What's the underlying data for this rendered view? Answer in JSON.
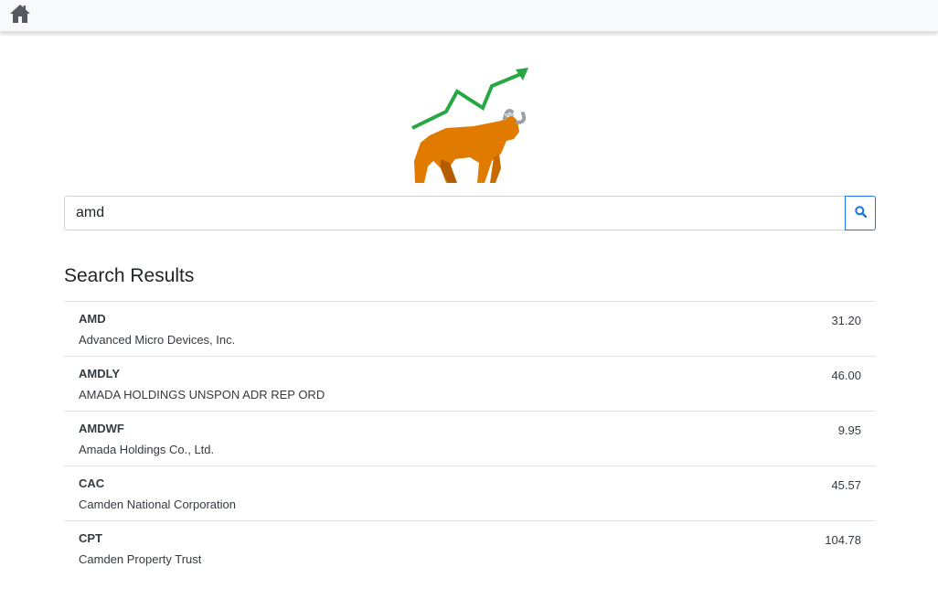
{
  "nav": {
    "home_icon": "home-icon"
  },
  "logo": {
    "icon": "bull-with-rising-chart-logo",
    "colors": {
      "arrow": "#27a844",
      "bull": "#e07b00",
      "bull_dark": "#b35c00",
      "horn": "#9aa0a6"
    }
  },
  "search": {
    "value": "amd",
    "icon": "search-icon",
    "accent": "#1a73e8"
  },
  "results": {
    "title": "Search Results",
    "items": [
      {
        "symbol": "AMD",
        "name": "Advanced Micro Devices, Inc.",
        "price": "31.20"
      },
      {
        "symbol": "AMDLY",
        "name": "AMADA HOLDINGS UNSPON ADR REP ORD",
        "price": "46.00"
      },
      {
        "symbol": "AMDWF",
        "name": "Amada Holdings Co., Ltd.",
        "price": "9.95"
      },
      {
        "symbol": "CAC",
        "name": "Camden National Corporation",
        "price": "45.57"
      },
      {
        "symbol": "CPT",
        "name": "Camden Property Trust",
        "price": "104.78"
      }
    ]
  }
}
